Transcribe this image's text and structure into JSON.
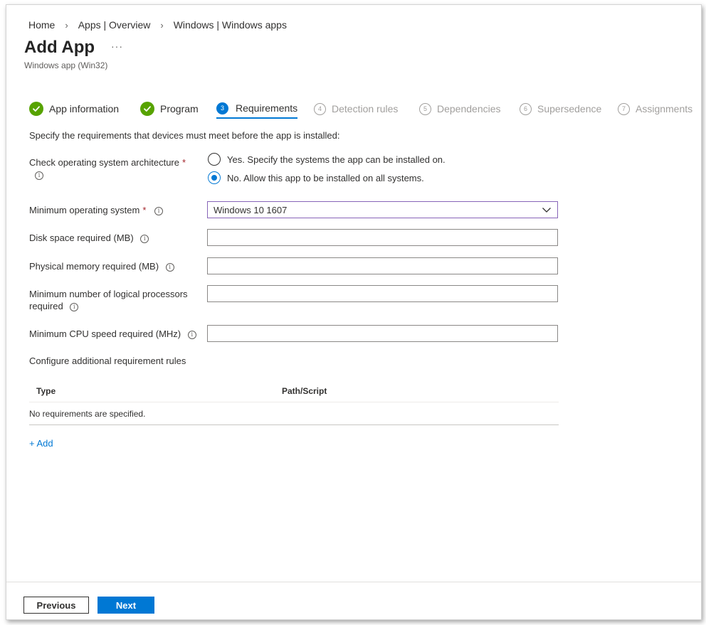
{
  "breadcrumb": [
    "Home",
    "Apps | Overview",
    "Windows | Windows apps"
  ],
  "header": {
    "title": "Add App",
    "more": "···",
    "subtitle": "Windows app (Win32)"
  },
  "steps": [
    {
      "label": "App information",
      "state": "done"
    },
    {
      "label": "Program",
      "state": "done"
    },
    {
      "number": "3",
      "label": "Requirements",
      "state": "active"
    },
    {
      "number": "4",
      "label": "Detection rules",
      "state": "pending"
    },
    {
      "number": "5",
      "label": "Dependencies",
      "state": "pending"
    },
    {
      "number": "6",
      "label": "Supersedence",
      "state": "pending"
    },
    {
      "number": "7",
      "label": "Assignments",
      "state": "pending"
    }
  ],
  "form": {
    "intro": "Specify the requirements that devices must meet before the app is installed:",
    "arch_label": "Check operating system architecture",
    "required_mark": "*",
    "arch_options": [
      {
        "label": "Yes. Specify the systems the app can be installed on.",
        "checked": false
      },
      {
        "label": "No. Allow this app to be installed on all systems.",
        "checked": true
      }
    ],
    "min_os_label": "Minimum operating system",
    "min_os_value": "Windows 10 1607",
    "disk_label": "Disk space required (MB)",
    "disk_value": "",
    "memory_label": "Physical memory required (MB)",
    "memory_value": "",
    "processors_label_line1": "Minimum number of logical processors",
    "processors_label_line2": "required",
    "processors_value": "",
    "cpu_label": "Minimum CPU speed required (MHz)",
    "cpu_value": "",
    "additional_heading": "Configure additional requirement rules",
    "info_glyph": "i"
  },
  "table": {
    "columns": [
      "Type",
      "Path/Script"
    ],
    "empty_text": "No requirements are specified."
  },
  "add_link": "+ Add",
  "footer": {
    "previous": "Previous",
    "next": "Next"
  },
  "colors": {
    "accent": "#0078d4",
    "done_green": "#57a300",
    "required_red": "#a4262c",
    "select_border": "#8764b8"
  }
}
